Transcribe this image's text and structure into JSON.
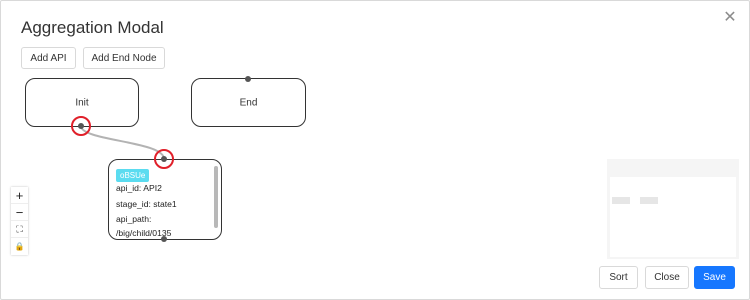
{
  "modal": {
    "title": "Aggregation Modal",
    "close_icon": "close-icon"
  },
  "toolbar": {
    "add_api_label": "Add API",
    "add_end_node_label": "Add End Node"
  },
  "canvas": {
    "nodes": {
      "init_label": "Init",
      "end_label": "End"
    },
    "api_node": {
      "tag": "oBSUe",
      "api_id": "api_id: API2",
      "stage_id": "stage_id: state1",
      "api_path_label": "api_path:",
      "api_path_value": "/big/child/0135"
    },
    "controls": {
      "zoom_in": "+",
      "zoom_out": "−",
      "fit": "⛶",
      "lock": "🔒"
    },
    "colors": {
      "edge": "#b3b3b3",
      "highlight_ring": "#e0202a",
      "tag_bg": "#5bdcf0"
    }
  },
  "footer": {
    "sort_label": "Sort",
    "close_label": "Close",
    "save_label": "Save",
    "primary_color": "#1677ff"
  }
}
